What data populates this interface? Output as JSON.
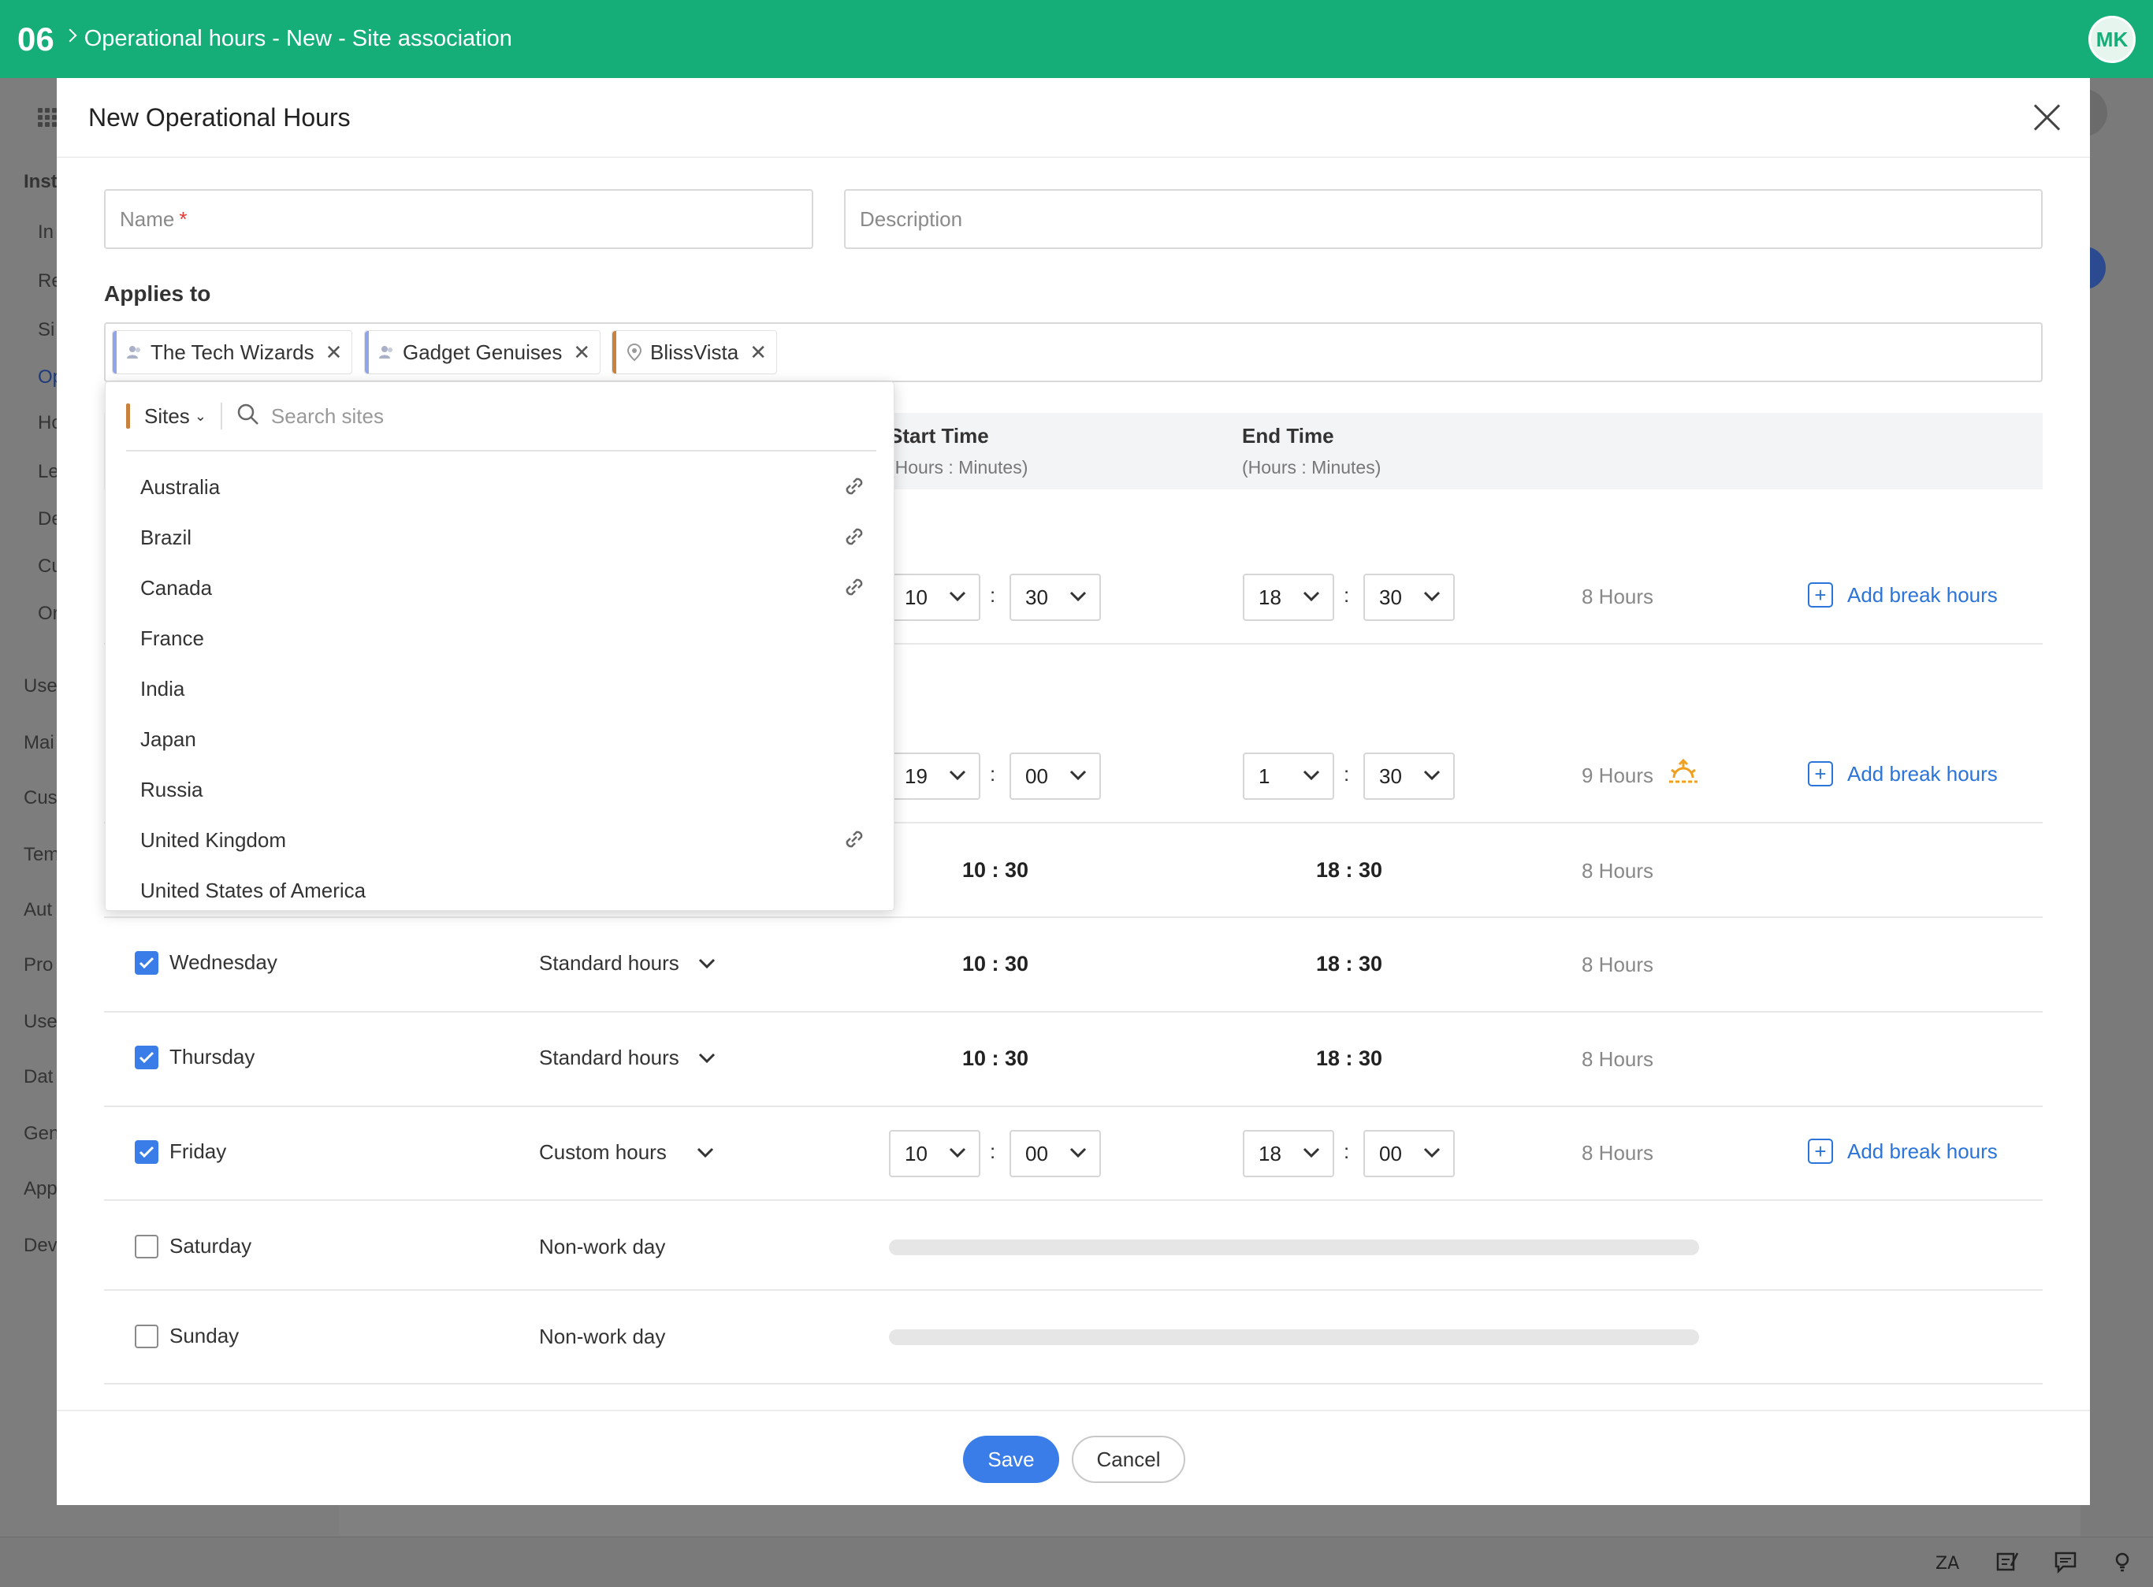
{
  "topbar": {
    "tab_number": "06",
    "title": "Operational hours - New - Site association",
    "avatar": "MK",
    "color": "#15ad78"
  },
  "background_nav": [
    "Inst",
    "In",
    "Re",
    "Si",
    "Op",
    "Ho",
    "Le",
    "De",
    "Cu",
    "Or",
    "Use",
    "Mai",
    "Cus",
    "Tem",
    "Aut",
    "Pro",
    "Use",
    "Dat",
    "Gen",
    "App",
    "Dev"
  ],
  "modal": {
    "title": "New Operational Hours",
    "name_placeholder": "Name",
    "name_required": "*",
    "description_placeholder": "Description",
    "applies_to_label": "Applies to",
    "chips": [
      {
        "label": "The Tech Wizards",
        "icon": "group-icon",
        "color": "#8fa5e8"
      },
      {
        "label": "Gadget Genuises",
        "icon": "group-icon",
        "color": "#8fa5e8"
      },
      {
        "label": "BlissVista",
        "icon": "location-pin-icon",
        "color": "#c8823e"
      }
    ],
    "table": {
      "col_start": "Start Time",
      "col_start_sub": "(Hours : Minutes)",
      "col_end": "End Time",
      "col_end_sub": "(Hours : Minutes)"
    },
    "rows": [
      {
        "start_h": "10",
        "start_m": "30",
        "end_h": "18",
        "end_m": "30",
        "total": "8 Hours",
        "add_break": "Add break hours"
      },
      {
        "start_h": "19",
        "start_m": "00",
        "end_h": "1",
        "end_m": "30",
        "total": "9 Hours",
        "add_break": "Add break hours"
      },
      {
        "start": "10 : 30",
        "end": "18 : 30",
        "total": "8 Hours"
      },
      {
        "day": "Wednesday",
        "type": "Standard hours",
        "start": "10 : 30",
        "end": "18 : 30",
        "total": "8 Hours",
        "checked": true
      },
      {
        "day": "Thursday",
        "type": "Standard hours",
        "start": "10 : 30",
        "end": "18 : 30",
        "total": "8 Hours",
        "checked": true
      },
      {
        "day": "Friday",
        "type": "Custom hours",
        "start_h": "10",
        "start_m": "00",
        "end_h": "18",
        "end_m": "00",
        "total": "8 Hours",
        "add_break": "Add break hours",
        "checked": true
      },
      {
        "day": "Saturday",
        "type": "Non-work day",
        "checked": false
      },
      {
        "day": "Sunday",
        "type": "Non-work day",
        "checked": false
      }
    ],
    "save_label": "Save",
    "cancel_label": "Cancel"
  },
  "dropdown": {
    "filter_label": "Sites",
    "search_placeholder": "Search sites",
    "items": [
      {
        "label": "Australia",
        "linked": true
      },
      {
        "label": "Brazil",
        "linked": true
      },
      {
        "label": "Canada",
        "linked": true
      },
      {
        "label": "France",
        "linked": false
      },
      {
        "label": "India",
        "linked": false
      },
      {
        "label": "Japan",
        "linked": false
      },
      {
        "label": "Russia",
        "linked": false
      },
      {
        "label": "United Kingdom",
        "linked": true
      },
      {
        "label": "United States of America",
        "linked": false
      }
    ]
  },
  "colors": {
    "accent": "#3a7de8",
    "link": "#2b74d9",
    "overnight": "#f0a020"
  }
}
